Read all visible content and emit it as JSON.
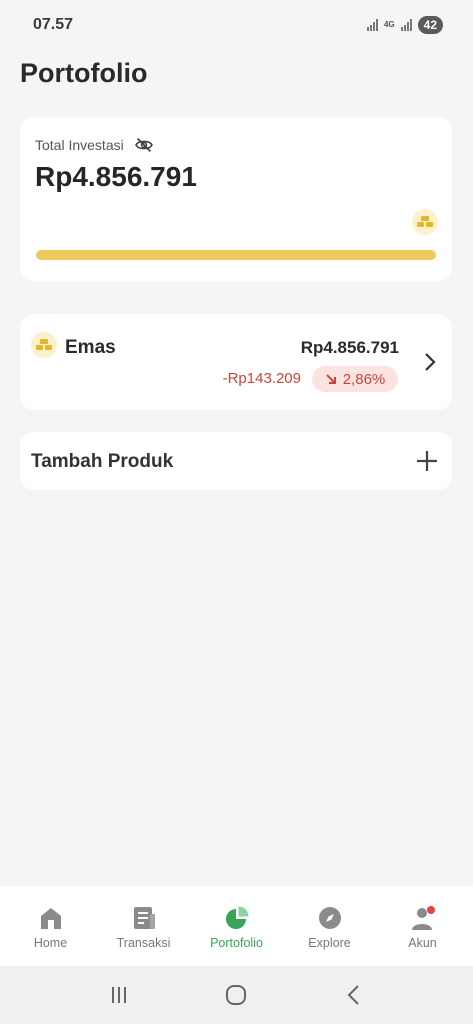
{
  "status_bar": {
    "time": "07.57",
    "network": "4G",
    "battery": "42"
  },
  "page": {
    "title": "Portofolio"
  },
  "total_card": {
    "label": "Total Investasi",
    "value": "Rp4.856.791",
    "progress_fraction": 1.0,
    "colors": {
      "bar": "#eccb5c",
      "track": "#eee3b2"
    }
  },
  "products": [
    {
      "icon": "gold-bars-icon",
      "name": "Emas",
      "value": "Rp4.856.791",
      "change_amount": "-Rp143.209",
      "change_percent": "2,86%",
      "trend": "down",
      "colors": {
        "loss": "#c9463d",
        "loss_bg": "#fbe3e0"
      }
    }
  ],
  "add_product": {
    "label": "Tambah Produk"
  },
  "bottom_nav": {
    "items": [
      {
        "label": "Home",
        "icon": "home-icon",
        "active": false
      },
      {
        "label": "Transaksi",
        "icon": "receipt-icon",
        "active": false
      },
      {
        "label": "Portofolio",
        "icon": "pie-chart-icon",
        "active": true
      },
      {
        "label": "Explore",
        "icon": "compass-icon",
        "active": false
      },
      {
        "label": "Akun",
        "icon": "user-icon",
        "active": false,
        "notification_dot": true
      }
    ],
    "active_color": "#3aa35a"
  }
}
